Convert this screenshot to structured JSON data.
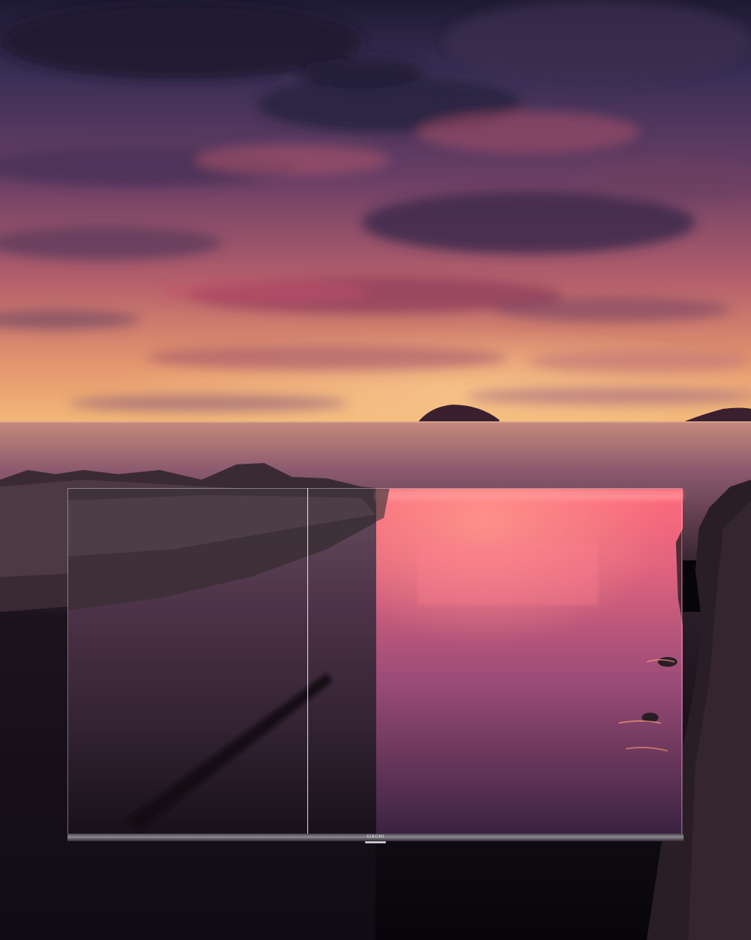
{
  "tv": {
    "brand_label": "XIAOMI"
  },
  "colors": {
    "sky_top": "#2b2440",
    "sky_glow": "#e0805e",
    "horizon": "#f0b070",
    "sea": "#a66a78",
    "screen_water": "#e9607a",
    "shore": "#120d14"
  }
}
